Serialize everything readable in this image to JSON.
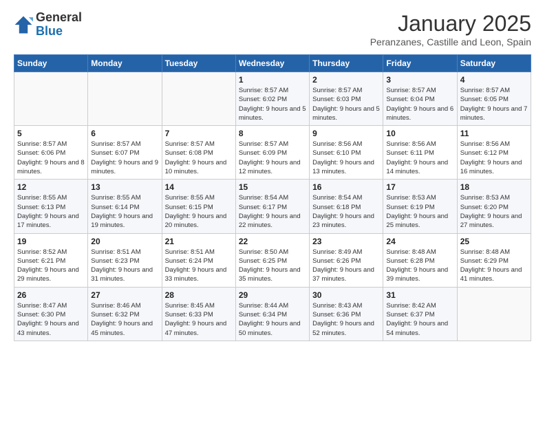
{
  "logo": {
    "general": "General",
    "blue": "Blue"
  },
  "header": {
    "month": "January 2025",
    "location": "Peranzanes, Castille and Leon, Spain"
  },
  "weekdays": [
    "Sunday",
    "Monday",
    "Tuesday",
    "Wednesday",
    "Thursday",
    "Friday",
    "Saturday"
  ],
  "weeks": [
    [
      {
        "day": "",
        "sunrise": "",
        "sunset": "",
        "daylight": ""
      },
      {
        "day": "",
        "sunrise": "",
        "sunset": "",
        "daylight": ""
      },
      {
        "day": "",
        "sunrise": "",
        "sunset": "",
        "daylight": ""
      },
      {
        "day": "1",
        "sunrise": "Sunrise: 8:57 AM",
        "sunset": "Sunset: 6:02 PM",
        "daylight": "Daylight: 9 hours and 5 minutes."
      },
      {
        "day": "2",
        "sunrise": "Sunrise: 8:57 AM",
        "sunset": "Sunset: 6:03 PM",
        "daylight": "Daylight: 9 hours and 5 minutes."
      },
      {
        "day": "3",
        "sunrise": "Sunrise: 8:57 AM",
        "sunset": "Sunset: 6:04 PM",
        "daylight": "Daylight: 9 hours and 6 minutes."
      },
      {
        "day": "4",
        "sunrise": "Sunrise: 8:57 AM",
        "sunset": "Sunset: 6:05 PM",
        "daylight": "Daylight: 9 hours and 7 minutes."
      }
    ],
    [
      {
        "day": "5",
        "sunrise": "Sunrise: 8:57 AM",
        "sunset": "Sunset: 6:06 PM",
        "daylight": "Daylight: 9 hours and 8 minutes."
      },
      {
        "day": "6",
        "sunrise": "Sunrise: 8:57 AM",
        "sunset": "Sunset: 6:07 PM",
        "daylight": "Daylight: 9 hours and 9 minutes."
      },
      {
        "day": "7",
        "sunrise": "Sunrise: 8:57 AM",
        "sunset": "Sunset: 6:08 PM",
        "daylight": "Daylight: 9 hours and 10 minutes."
      },
      {
        "day": "8",
        "sunrise": "Sunrise: 8:57 AM",
        "sunset": "Sunset: 6:09 PM",
        "daylight": "Daylight: 9 hours and 12 minutes."
      },
      {
        "day": "9",
        "sunrise": "Sunrise: 8:56 AM",
        "sunset": "Sunset: 6:10 PM",
        "daylight": "Daylight: 9 hours and 13 minutes."
      },
      {
        "day": "10",
        "sunrise": "Sunrise: 8:56 AM",
        "sunset": "Sunset: 6:11 PM",
        "daylight": "Daylight: 9 hours and 14 minutes."
      },
      {
        "day": "11",
        "sunrise": "Sunrise: 8:56 AM",
        "sunset": "Sunset: 6:12 PM",
        "daylight": "Daylight: 9 hours and 16 minutes."
      }
    ],
    [
      {
        "day": "12",
        "sunrise": "Sunrise: 8:55 AM",
        "sunset": "Sunset: 6:13 PM",
        "daylight": "Daylight: 9 hours and 17 minutes."
      },
      {
        "day": "13",
        "sunrise": "Sunrise: 8:55 AM",
        "sunset": "Sunset: 6:14 PM",
        "daylight": "Daylight: 9 hours and 19 minutes."
      },
      {
        "day": "14",
        "sunrise": "Sunrise: 8:55 AM",
        "sunset": "Sunset: 6:15 PM",
        "daylight": "Daylight: 9 hours and 20 minutes."
      },
      {
        "day": "15",
        "sunrise": "Sunrise: 8:54 AM",
        "sunset": "Sunset: 6:17 PM",
        "daylight": "Daylight: 9 hours and 22 minutes."
      },
      {
        "day": "16",
        "sunrise": "Sunrise: 8:54 AM",
        "sunset": "Sunset: 6:18 PM",
        "daylight": "Daylight: 9 hours and 23 minutes."
      },
      {
        "day": "17",
        "sunrise": "Sunrise: 8:53 AM",
        "sunset": "Sunset: 6:19 PM",
        "daylight": "Daylight: 9 hours and 25 minutes."
      },
      {
        "day": "18",
        "sunrise": "Sunrise: 8:53 AM",
        "sunset": "Sunset: 6:20 PM",
        "daylight": "Daylight: 9 hours and 27 minutes."
      }
    ],
    [
      {
        "day": "19",
        "sunrise": "Sunrise: 8:52 AM",
        "sunset": "Sunset: 6:21 PM",
        "daylight": "Daylight: 9 hours and 29 minutes."
      },
      {
        "day": "20",
        "sunrise": "Sunrise: 8:51 AM",
        "sunset": "Sunset: 6:23 PM",
        "daylight": "Daylight: 9 hours and 31 minutes."
      },
      {
        "day": "21",
        "sunrise": "Sunrise: 8:51 AM",
        "sunset": "Sunset: 6:24 PM",
        "daylight": "Daylight: 9 hours and 33 minutes."
      },
      {
        "day": "22",
        "sunrise": "Sunrise: 8:50 AM",
        "sunset": "Sunset: 6:25 PM",
        "daylight": "Daylight: 9 hours and 35 minutes."
      },
      {
        "day": "23",
        "sunrise": "Sunrise: 8:49 AM",
        "sunset": "Sunset: 6:26 PM",
        "daylight": "Daylight: 9 hours and 37 minutes."
      },
      {
        "day": "24",
        "sunrise": "Sunrise: 8:48 AM",
        "sunset": "Sunset: 6:28 PM",
        "daylight": "Daylight: 9 hours and 39 minutes."
      },
      {
        "day": "25",
        "sunrise": "Sunrise: 8:48 AM",
        "sunset": "Sunset: 6:29 PM",
        "daylight": "Daylight: 9 hours and 41 minutes."
      }
    ],
    [
      {
        "day": "26",
        "sunrise": "Sunrise: 8:47 AM",
        "sunset": "Sunset: 6:30 PM",
        "daylight": "Daylight: 9 hours and 43 minutes."
      },
      {
        "day": "27",
        "sunrise": "Sunrise: 8:46 AM",
        "sunset": "Sunset: 6:32 PM",
        "daylight": "Daylight: 9 hours and 45 minutes."
      },
      {
        "day": "28",
        "sunrise": "Sunrise: 8:45 AM",
        "sunset": "Sunset: 6:33 PM",
        "daylight": "Daylight: 9 hours and 47 minutes."
      },
      {
        "day": "29",
        "sunrise": "Sunrise: 8:44 AM",
        "sunset": "Sunset: 6:34 PM",
        "daylight": "Daylight: 9 hours and 50 minutes."
      },
      {
        "day": "30",
        "sunrise": "Sunrise: 8:43 AM",
        "sunset": "Sunset: 6:36 PM",
        "daylight": "Daylight: 9 hours and 52 minutes."
      },
      {
        "day": "31",
        "sunrise": "Sunrise: 8:42 AM",
        "sunset": "Sunset: 6:37 PM",
        "daylight": "Daylight: 9 hours and 54 minutes."
      },
      {
        "day": "",
        "sunrise": "",
        "sunset": "",
        "daylight": ""
      }
    ]
  ]
}
